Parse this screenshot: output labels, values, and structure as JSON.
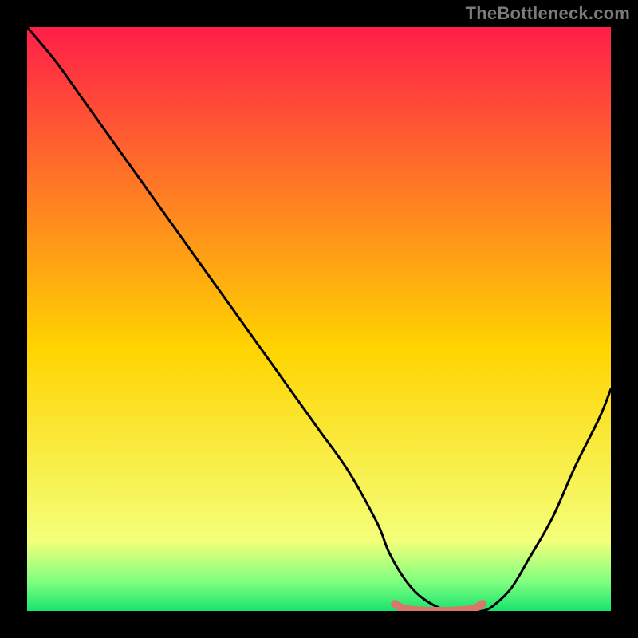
{
  "watermark": "TheBottleneck.com",
  "colors": {
    "background": "#000000",
    "watermark_text": "#7b7b7b",
    "curve": "#000000",
    "highlight": "#d9776b",
    "gradient_top": "#ff1e49",
    "gradient_mid": "#ffd400",
    "gradient_band_top": "#f4ff7a",
    "gradient_band_bot": "#7fff7f",
    "gradient_bottom": "#19e36e"
  },
  "chart_data": {
    "type": "line",
    "title": "",
    "xlabel": "",
    "ylabel": "",
    "xlim": [
      0,
      100
    ],
    "ylim": [
      0,
      100
    ],
    "x": [
      0,
      5,
      10,
      15,
      20,
      25,
      30,
      35,
      40,
      45,
      50,
      55,
      60,
      62,
      65,
      68,
      72,
      75,
      78,
      80,
      83,
      86,
      90,
      94,
      98,
      100
    ],
    "values": [
      100,
      94,
      87,
      80,
      73,
      66,
      59,
      52,
      45,
      38,
      31,
      24,
      15,
      10,
      5,
      2,
      0,
      0,
      0,
      1,
      4,
      9,
      16,
      25,
      33,
      38
    ],
    "optimal_range_x": [
      63,
      78
    ],
    "optimal_y": 0
  }
}
